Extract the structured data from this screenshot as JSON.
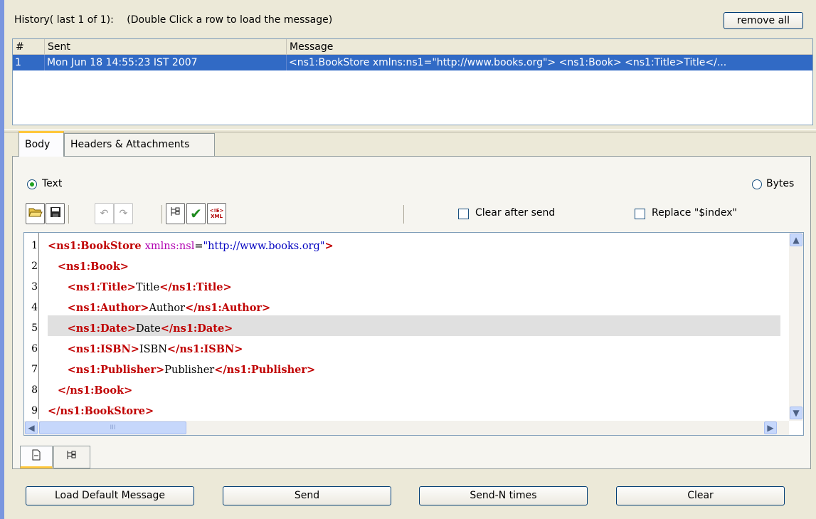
{
  "history": {
    "title": "History( last 1 of 1):",
    "hint": "(Double Click a row to load the message)",
    "remove_all_label": "remove all",
    "columns": [
      "#",
      "Sent",
      "Message"
    ],
    "rows": [
      {
        "index": "1",
        "sent": "Mon Jun 18 14:55:23 IST 2007",
        "message": "<ns1:BookStore xmlns:ns1=\"http://www.books.org\">   <ns1:Book>       <ns1:Title>Title</..."
      }
    ]
  },
  "tabs": [
    {
      "label": "Body",
      "active": true
    },
    {
      "label": "Headers & Attachments",
      "active": false
    }
  ],
  "format": {
    "text_label": "Text",
    "bytes_label": "Bytes",
    "selected": "Text"
  },
  "options": {
    "clear_after_send_label": "Clear after send",
    "clear_after_send_checked": false,
    "replace_index_label": "Replace \"$index\"",
    "replace_index_checked": false
  },
  "toolbar": {
    "icons": [
      "open-folder-icon",
      "save-disk-icon",
      "undo-icon",
      "redo-icon",
      "xml-tree-icon",
      "validate-check-icon",
      "xml-escape-icon"
    ],
    "escape_icon_text": "<!E>\nXML"
  },
  "editor": {
    "highlighted_line": 5,
    "line_numbers": [
      "1",
      "2",
      "3",
      "4",
      "5",
      "6",
      "7",
      "8",
      "9"
    ],
    "lines": [
      {
        "indent": "",
        "parts": [
          [
            "tag",
            "<ns1:BookStore "
          ],
          [
            "attr",
            "xmlns:nsl"
          ],
          [
            "txt",
            "="
          ],
          [
            "str",
            "\"http://www.books.org\""
          ],
          [
            "tag",
            ">"
          ]
        ]
      },
      {
        "indent": "   ",
        "parts": [
          [
            "tag",
            "<ns1:Book>"
          ]
        ]
      },
      {
        "indent": "      ",
        "parts": [
          [
            "tag",
            "<ns1:Title>"
          ],
          [
            "txt",
            "Title"
          ],
          [
            "tag",
            "</ns1:Title>"
          ]
        ]
      },
      {
        "indent": "      ",
        "parts": [
          [
            "tag",
            "<ns1:Author>"
          ],
          [
            "txt",
            "Author"
          ],
          [
            "tag",
            "</ns1:Author>"
          ]
        ]
      },
      {
        "indent": "      ",
        "parts": [
          [
            "tag",
            "<ns1:Date>"
          ],
          [
            "txt",
            "Date"
          ],
          [
            "tag",
            "</ns1:Date>"
          ]
        ]
      },
      {
        "indent": "      ",
        "parts": [
          [
            "tag",
            "<ns1:ISBN>"
          ],
          [
            "txt",
            "ISBN"
          ],
          [
            "tag",
            "</ns1:ISBN>"
          ]
        ]
      },
      {
        "indent": "      ",
        "parts": [
          [
            "tag",
            "<ns1:Publisher>"
          ],
          [
            "txt",
            "Publisher"
          ],
          [
            "tag",
            "</ns1:Publisher>"
          ]
        ]
      },
      {
        "indent": "   ",
        "parts": [
          [
            "tag",
            "</ns1:Book>"
          ]
        ]
      },
      {
        "indent": "",
        "parts": [
          [
            "tag",
            "</ns1:BookStore>"
          ]
        ]
      }
    ],
    "hscroll_grip": "III"
  },
  "view_tabs": [
    {
      "icon": "document-view-icon",
      "active": true
    },
    {
      "icon": "tree-view-icon",
      "active": false
    }
  ],
  "actions": {
    "load_default_label": "Load Default Message",
    "send_label": "Send",
    "send_n_label": "Send-N times",
    "clear_label": "Clear"
  },
  "colors": {
    "selection": "#316ac5",
    "xml_tag": "#c00000",
    "xml_attr": "#b000b0",
    "xml_string": "#0000c0",
    "tab_accent": "#ffc73c"
  }
}
